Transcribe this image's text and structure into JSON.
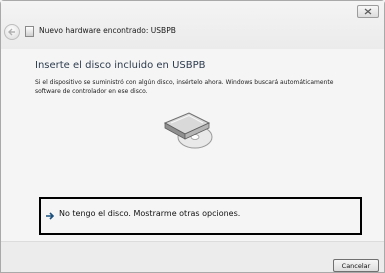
{
  "titlebar": {
    "title": "Nuevo hardware encontrado: USBPB",
    "close_icon": "close-icon",
    "back_icon": "back-arrow-icon",
    "device_icon": "device-icon"
  },
  "main": {
    "heading": "Inserte el disco incluido en USBPB",
    "description": "Si el dispositivo se suministró con algún disco, insértelo ahora. Windows buscará automáticamente software de controlador en ese disco.",
    "illustration_icon": "disc-drive-icon",
    "option": {
      "icon": "arrow-right-icon",
      "label": "No tengo el disco. Mostrarme otras opciones."
    }
  },
  "footer": {
    "cancel_label": "Cancelar"
  },
  "colors": {
    "heading": "#2e3d4f",
    "window_bg": "#ececec",
    "content_bg": "#f5f5f5",
    "option_border": "#000000"
  }
}
